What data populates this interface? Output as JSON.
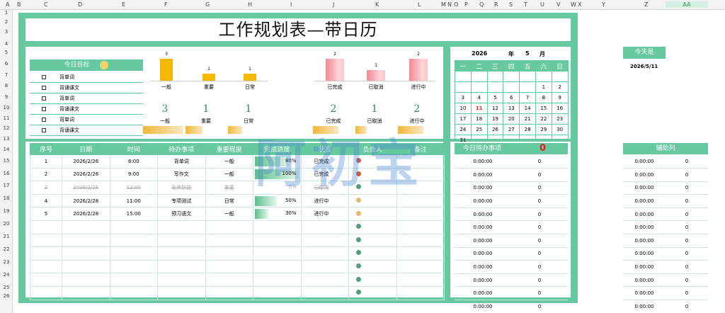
{
  "columns": [
    "A",
    "B",
    "C",
    "D",
    "E",
    "F",
    "G",
    "H",
    "I",
    "J",
    "K",
    "L",
    "M",
    "N",
    "O",
    "P",
    "Q",
    "R",
    "S",
    "T",
    "U",
    "V",
    "W",
    "X",
    "Y",
    "Z",
    "AA"
  ],
  "rows": [
    "1",
    "2",
    "3",
    "4",
    "5",
    "6",
    "7",
    "8",
    "9",
    "10",
    "11",
    "12",
    "13",
    "14",
    "15",
    "16",
    "17",
    "18",
    "19",
    "20",
    "21",
    "22",
    "23",
    "24",
    "25",
    "26"
  ],
  "title": "工作规划表—带日历",
  "goals": {
    "header": "今日目标",
    "items": [
      "背单词",
      "背诵课文",
      "背单词",
      "背诵课文",
      "背单词",
      "背诵课文"
    ]
  },
  "priority_chart": {
    "counts": [
      "3",
      "1",
      "1"
    ],
    "values": [
      3,
      1,
      1
    ],
    "labels": [
      "一般",
      "重要",
      "日常"
    ]
  },
  "status_chart": {
    "counts": [
      "2",
      "1",
      "2"
    ],
    "values": [
      2,
      1,
      2
    ],
    "labels": [
      "已完成",
      "已取消",
      "进行中"
    ]
  },
  "summary": {
    "priority_nums": [
      "3",
      "1",
      "1"
    ],
    "priority_labels": [
      "一般",
      "重要",
      "日常"
    ],
    "status_nums": [
      "2",
      "1",
      "2"
    ],
    "status_labels": [
      "已完成",
      "已取消",
      "进行中"
    ]
  },
  "task_table": {
    "headers": [
      "序号",
      "日期",
      "时间",
      "待办事项",
      "重要程度",
      "完成进度",
      "状态",
      "负责人",
      "备注"
    ],
    "rows": [
      {
        "no": "1",
        "date": "2026/2/26",
        "time": "8:00",
        "task": "背单词",
        "level": "一般",
        "progress": "80%",
        "progress_value": 0.8,
        "status": "已完成",
        "dot": "#d9573c"
      },
      {
        "no": "2",
        "date": "2026/2/26",
        "time": "9:00",
        "task": "写作文",
        "level": "一般",
        "progress": "100%",
        "progress_value": 1.0,
        "status": "已完成",
        "dot": "#d9573c"
      },
      {
        "no": "3",
        "date": "2026/2/26",
        "time": "12:00",
        "task": "写典卧题",
        "level": "重要",
        "progress": "0%",
        "progress_value": 0,
        "status": "已取消",
        "dot": "#4f9e76"
      },
      {
        "no": "4",
        "date": "2026/2/28",
        "time": "11:00",
        "task": "专项测试",
        "level": "日常",
        "progress": "50%",
        "progress_value": 0.5,
        "status": "进行中",
        "dot": "#e8b86a"
      },
      {
        "no": "5",
        "date": "2026/2/28",
        "time": "15:00",
        "task": "预习语文",
        "level": "一般",
        "progress": "30%",
        "progress_value": 0.3,
        "status": "进行中",
        "dot": "#e8b86a"
      }
    ],
    "empty_rows": 6
  },
  "calendar": {
    "year": "2026",
    "year_label": "年",
    "month": "5",
    "month_label": "月",
    "weekdays": [
      "一",
      "二",
      "三",
      "四",
      "五",
      "六",
      "日"
    ],
    "weeks": [
      [
        "",
        "",
        "",
        "",
        "",
        "",
        ""
      ],
      [
        "",
        "",
        "",
        "",
        "",
        "1",
        "2"
      ],
      [
        "3",
        "4",
        "5",
        "6",
        "7",
        "8",
        "9"
      ],
      [
        "10",
        "11",
        "12",
        "13",
        "14",
        "15",
        "16"
      ],
      [
        "17",
        "18",
        "19",
        "20",
        "21",
        "22",
        "23"
      ],
      [
        "24",
        "25",
        "26",
        "27",
        "28",
        "29",
        "30"
      ],
      [
        "31",
        "",
        "",
        "",
        "",
        "",
        ""
      ]
    ],
    "today": "11"
  },
  "today_panel": {
    "label": "今天是",
    "date": "2026/5/11"
  },
  "todo_panel": {
    "header": "今日待办事项",
    "count": "0",
    "rows": 13,
    "time": "0:00:00",
    "value": "0"
  },
  "aux_panel": {
    "header": "辅助列",
    "rows": 13,
    "time": "0:00:00",
    "value": "0"
  },
  "watermark": "阿初宝"
}
